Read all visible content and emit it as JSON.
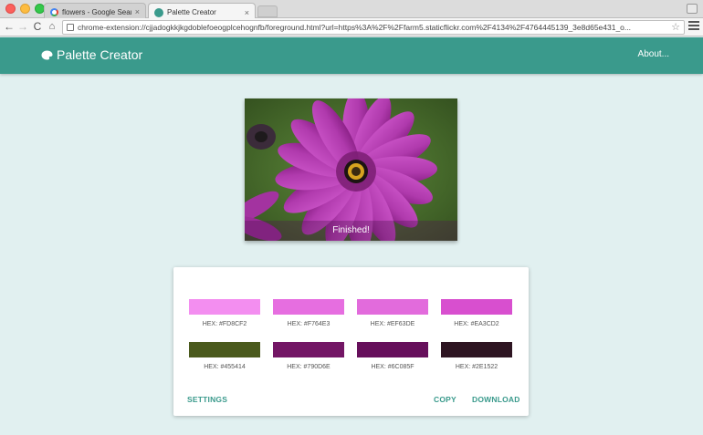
{
  "browser": {
    "tabs": [
      {
        "title": "flowers - Google Search",
        "favicon": "google-icon"
      },
      {
        "title": "Palette Creator",
        "favicon": "palette-icon"
      }
    ],
    "close_glyph": "×",
    "address": "chrome-extension://cjjadogkkjkgdoblefoeogplcehognfb/foreground.html?url=https%3A%2F%2Ffarm5.staticflickr.com%2F4134%2F4764445139_3e8d65e431_o...",
    "nav": {
      "back": "←",
      "forward": "→",
      "reload": "C",
      "home": "⌂"
    },
    "star": "☆"
  },
  "app": {
    "title": "Palette Creator",
    "about": "About...",
    "accent_color": "#3a9a8c",
    "background_color": "#e1f0f0"
  },
  "image": {
    "caption": "Finished!"
  },
  "palette": {
    "swatches": [
      {
        "hex_label": "HEX: #FD8CF2",
        "color": "#f38ef0"
      },
      {
        "hex_label": "HEX: #F764E3",
        "color": "#e66ee0"
      },
      {
        "hex_label": "HEX: #EF63DE",
        "color": "#e26bdc"
      },
      {
        "hex_label": "HEX: #EA3CD2",
        "color": "#d84fcf"
      },
      {
        "hex_label": "HEX: #455414",
        "color": "#4a5a1d"
      },
      {
        "hex_label": "HEX: #790D6E",
        "color": "#731665"
      },
      {
        "hex_label": "HEX: #6C085F",
        "color": "#660f5b"
      },
      {
        "hex_label": "HEX: #2E1522",
        "color": "#2e1522"
      }
    ],
    "actions": {
      "settings": "SETTINGS",
      "copy": "COPY",
      "download": "DOWNLOAD"
    }
  }
}
